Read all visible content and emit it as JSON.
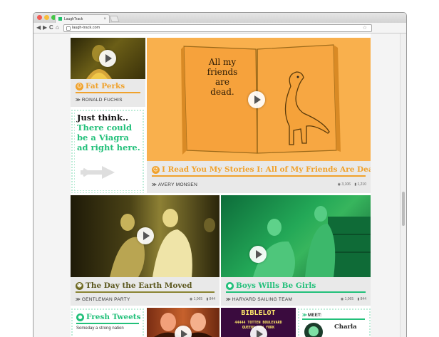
{
  "browser": {
    "tab_title": "LaughTrack",
    "tab_close": "×",
    "url": "laugh-track.com",
    "back": "◀",
    "forward": "▶",
    "reload": "C",
    "home": "⌂",
    "star": "☆",
    "menu": "≡"
  },
  "colors": {
    "orange": "#f6b23c",
    "green": "#22c07a",
    "dark_green": "#0f8f58",
    "olive": "#6f6a22",
    "cap_bg": "#e9e9e9"
  },
  "cards": {
    "fat_perks": {
      "title": "Fat Perks",
      "author": "RONALD FUCHIS",
      "icon": "smile-icon"
    },
    "ad": {
      "text": "Just think.. There could be a Viagra ad right here.",
      "line1": "Just think..",
      "line2": "There could",
      "line3": "be a Viagra",
      "line4": "ad right here."
    },
    "stories": {
      "title": "I Read You My Stories I: All of My Friends Are Dead",
      "author": "AVERY MONSEN",
      "views": "3,106",
      "likes": "1,210",
      "book_text1": "All my",
      "book_text2": "friends",
      "book_text3": "are dead."
    },
    "earth": {
      "title": "The Day the Earth Moved",
      "author": "GENTLEMAN PARTY",
      "views": "1,065",
      "likes": "844"
    },
    "boys": {
      "title": "Boys Wills Be Girls",
      "author": "HARVARD SAILING TEAM",
      "views": "1,065",
      "likes": "844"
    },
    "tweets": {
      "title": "Fresh Tweets",
      "preview": "Someday a strong nation"
    },
    "biblelot": {
      "heading": "BIBLELOT",
      "line1": "44444 TOTTEN BOULEVARD",
      "line2": "QUEENS NEW YORK"
    },
    "meet": {
      "label": "MEET:",
      "name": "Charla"
    }
  }
}
